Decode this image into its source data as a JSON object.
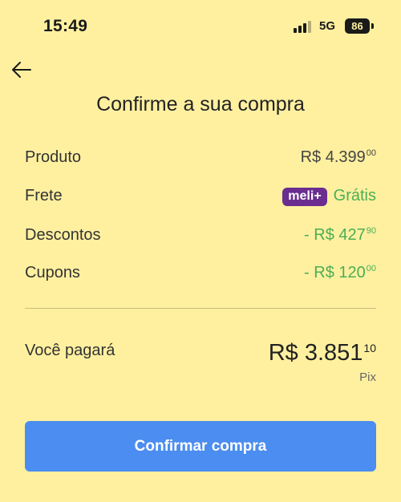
{
  "status_bar": {
    "time": "15:49",
    "network": "5G",
    "battery": "86"
  },
  "header": {
    "title": "Confirme a sua compra"
  },
  "summary": {
    "rows": [
      {
        "label": "Produto",
        "value_main": "R$ 4.399",
        "value_cents": "00"
      },
      {
        "label": "Frete",
        "badge": "meli+",
        "value_main": "Grátis"
      },
      {
        "label": "Descontos",
        "value_main": "- R$ 427",
        "value_cents": "90"
      },
      {
        "label": "Cupons",
        "value_main": "- R$ 120",
        "value_cents": "00"
      }
    ]
  },
  "total": {
    "label": "Você pagará",
    "amount_main": "R$ 3.851",
    "amount_cents": "10",
    "payment_method": "Pix"
  },
  "actions": {
    "confirm_label": "Confirmar compra"
  },
  "colors": {
    "background": "#FFF0A0",
    "discount_green": "#4BAE55",
    "button_blue": "#4B8DF0",
    "meli_purple": "#6B2D8F"
  }
}
